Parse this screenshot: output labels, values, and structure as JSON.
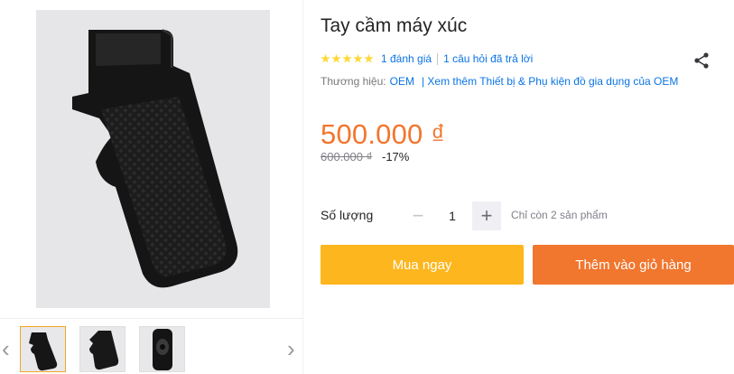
{
  "product": {
    "title": "Tay cầm máy xúc",
    "rating_stars": 5,
    "review_count_text": "1 đánh giá",
    "qa_text": "1 câu hỏi đã trả lời",
    "brand_label": "Thương hiệu:",
    "brand_name": "OEM",
    "brand_more_link": "| Xem thêm Thiết bị & Phụ kiện đồ gia dụng của OEM"
  },
  "pricing": {
    "price": "500.000 ₫",
    "old_price": "600.000 ₫",
    "discount": "-17%"
  },
  "quantity": {
    "label": "Số lượng",
    "value": "1",
    "minus_symbol": "−",
    "plus_symbol": "+",
    "stock_note": "Chỉ còn 2 sản phẩm"
  },
  "actions": {
    "buy_now_label": "Mua ngay",
    "add_to_cart_label": "Thêm vào giỏ hàng"
  },
  "gallery": {
    "prev_arrow": "‹",
    "next_arrow": "›",
    "thumbnail_count": 3,
    "active_thumbnail": 1
  },
  "icons": {
    "share": "share-icon"
  },
  "colors": {
    "price": "#f1762e",
    "buy_now": "#fdb61d",
    "add_to_cart": "#f1762e",
    "link": "#0b74e5",
    "star": "#fdd835"
  }
}
